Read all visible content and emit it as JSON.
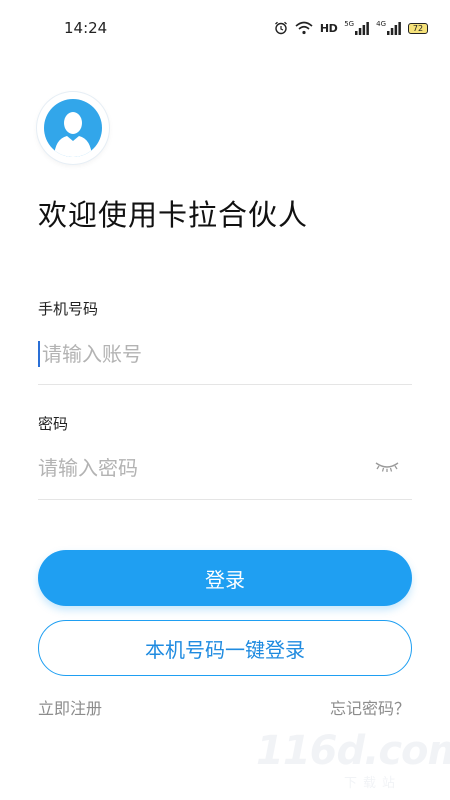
{
  "status_bar": {
    "time": "14:24",
    "hd_label": "HD",
    "signal1_label": "5G",
    "signal2_label": "4G",
    "battery": "72"
  },
  "header": {
    "welcome": "欢迎使用卡拉合伙人"
  },
  "form": {
    "phone_label": "手机号码",
    "phone_placeholder": "请输入账号",
    "phone_value": "",
    "password_label": "密码",
    "password_placeholder": "请输入密码",
    "password_value": ""
  },
  "actions": {
    "login_label": "登录",
    "onekey_label": "本机号码一键登录",
    "register_label": "立即注册",
    "forgot_label": "忘记密码？"
  },
  "watermark": {
    "main": "116d.com",
    "sub": "下载站"
  },
  "colors": {
    "accent": "#1f9ff2",
    "avatar": "#32a6ea"
  },
  "icons": [
    "alarm-icon",
    "wifi-icon",
    "signal-icon",
    "battery-icon",
    "avatar-icon",
    "eye-closed-icon"
  ]
}
